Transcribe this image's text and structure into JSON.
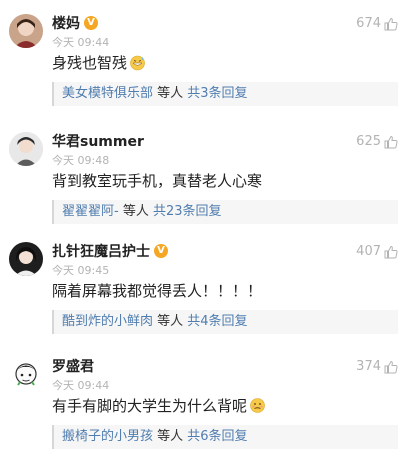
{
  "colors": {
    "link": "#507daf",
    "vbadge": "#f5a623",
    "muted": "#b3b3b3"
  },
  "comments": [
    {
      "username": "楼妈",
      "verified": true,
      "time": "今天 09:44",
      "likes": "674",
      "text": "身残也智残",
      "emoji": "sweat-smile-icon",
      "reply_user": "美女模特俱乐部",
      "reply_mid": " 等人 ",
      "reply_total": "共3条回复"
    },
    {
      "username": "华君summer",
      "verified": false,
      "time": "今天 09:48",
      "likes": "625",
      "text": "背到教室玩手机，真替老人心寒",
      "reply_user": "翟翟翟阿-",
      "reply_mid": " 等人 ",
      "reply_total": "共23条回复"
    },
    {
      "username": "扎针狂魔吕护士",
      "verified": true,
      "time": "今天 09:45",
      "likes": "407",
      "text": "隔着屏幕我都觉得丢人！！！！",
      "reply_user": "酷到炸的小鲜肉",
      "reply_mid": " 等人 ",
      "reply_total": "共4条回复"
    },
    {
      "username": "罗盛君",
      "verified": false,
      "time": "今天 09:44",
      "likes": "374",
      "text": "有手有脚的大学生为什么背呢",
      "emoji": "awkward-face-icon",
      "reply_user": "搬椅子的小男孩",
      "reply_mid": " 等人 ",
      "reply_total": "共6条回复"
    }
  ]
}
